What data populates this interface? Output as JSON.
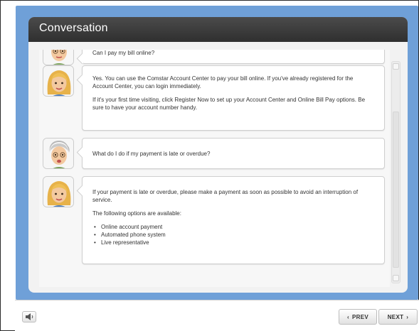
{
  "window": {
    "title": "Conversation"
  },
  "conversation": {
    "messages": [
      {
        "speaker": "customer",
        "paragraphs": [
          "Can I pay my bill online?"
        ]
      },
      {
        "speaker": "agent",
        "paragraphs": [
          "Yes. You can use the Comstar Account Center to pay your bill online. If you've already registered for the Account Center, you can login immediately.",
          "If it's your first time visiting, click Register Now to set up your Account Center and Online Bill Pay options. Be sure to have your account number handy."
        ]
      },
      {
        "speaker": "customer",
        "paragraphs": [
          "What do I do if my payment is late or overdue?"
        ]
      },
      {
        "speaker": "agent",
        "paragraphs": [
          "If your payment is late or overdue, please make a payment as soon as possible to avoid an interruption of service.",
          "The following options are available:"
        ],
        "bullets": [
          "Online account payment",
          "Automated phone system",
          "Live representative"
        ]
      }
    ]
  },
  "controls": {
    "audio_icon": "speaker-icon",
    "prev_label": "PREV",
    "prev_icon": "‹",
    "next_label": "NEXT",
    "next_icon": "›"
  },
  "colors": {
    "stage_background": "#6fa0d8",
    "header_background": "#3b3b3b"
  }
}
